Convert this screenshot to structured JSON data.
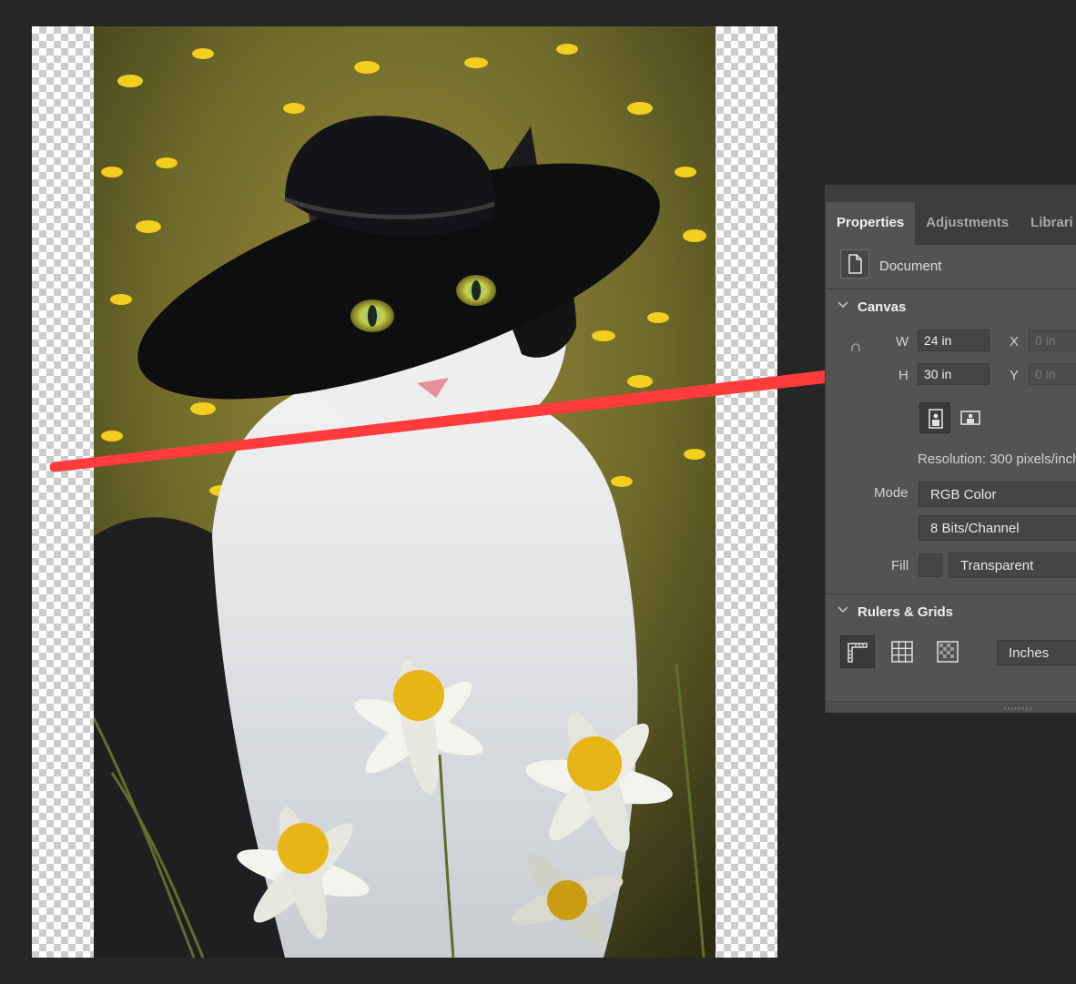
{
  "panel": {
    "tabs": [
      "Properties",
      "Adjustments",
      "Librari"
    ],
    "document_label": "Document",
    "canvas": {
      "section_title": "Canvas",
      "w_label": "W",
      "w_value": "24 in",
      "h_label": "H",
      "h_value": "30 in",
      "x_label": "X",
      "x_value": "0 in",
      "y_label": "Y",
      "y_value": "0 in",
      "resolution": "Resolution: 300 pixels/inch",
      "mode_label": "Mode",
      "mode_value": "RGB Color",
      "bits_value": "8 Bits/Channel",
      "fill_label": "Fill",
      "fill_value": "Transparent"
    },
    "rulers": {
      "section_title": "Rulers & Grids",
      "units_value": "Inches"
    }
  },
  "colors": {
    "app_background": "#262626",
    "panel_background": "#535353",
    "annotation_arrow": "#ff3b3b"
  },
  "icons": [
    "document-icon",
    "chevron-down-icon",
    "link-icon",
    "portrait-orientation-icon",
    "landscape-orientation-icon",
    "rulers-icon",
    "grid-icon",
    "guides-icon"
  ]
}
